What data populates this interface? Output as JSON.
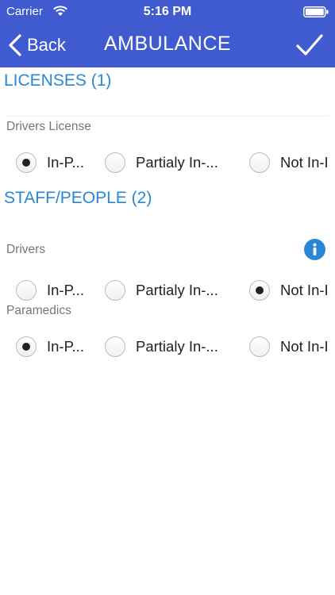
{
  "status_bar": {
    "carrier": "Carrier",
    "time": "5:16 PM"
  },
  "nav": {
    "back_label": "Back",
    "title": "AMBULANCE"
  },
  "colors": {
    "nav_bg": "#3f5bcf",
    "section_title": "#2a87d6",
    "info_icon": "#2a87d6"
  },
  "sections": [
    {
      "title": "LICENSES (1)",
      "fields": [
        {
          "label": "Drivers License",
          "options": [
            "In-P...",
            "Partialy In-...",
            "Not In-I"
          ],
          "selected": 0
        }
      ]
    },
    {
      "title": "STAFF/PEOPLE (2)",
      "fields": [
        {
          "label": "Drivers",
          "options": [
            "In-P...",
            "Partialy In-...",
            "Not In-I"
          ],
          "selected": 2,
          "info_icon": "info-icon"
        },
        {
          "label": "Paramedics",
          "options": [
            "In-P...",
            "Partialy In-...",
            "Not In-I"
          ],
          "selected": 0
        }
      ]
    }
  ]
}
